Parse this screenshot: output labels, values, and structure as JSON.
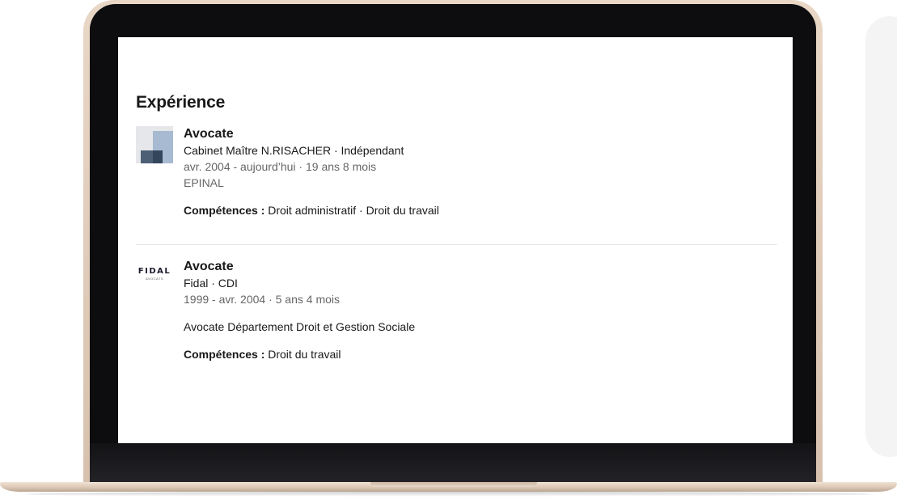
{
  "section": {
    "title": "Expérience"
  },
  "experiences": [
    {
      "title": "Avocate",
      "company_line": "Cabinet Maître N.RISACHER · Indépendant",
      "dates": "avr. 2004 - aujourd’hui · 19 ans 8 mois",
      "location": "EPINAL",
      "skills_label": "Compétences :",
      "skills": "Droit administratif · Droit du travail",
      "logo_icon": "company-placeholder-logo"
    },
    {
      "title": "Avocate",
      "company_line": "Fidal · CDI",
      "dates": "1999 - avr. 2004 · 5 ans 4 mois",
      "description": "Avocate Département Droit et Gestion Sociale",
      "skills_label": "Compétences :",
      "skills": "Droit du travail",
      "logo_word": "FIDAL",
      "logo_sub": "AVOCATS"
    }
  ],
  "colors": {
    "text": "#191919",
    "muted": "#666666",
    "laptop_frame": "#e9d7c6",
    "logo_blue": "#a7bad1"
  }
}
